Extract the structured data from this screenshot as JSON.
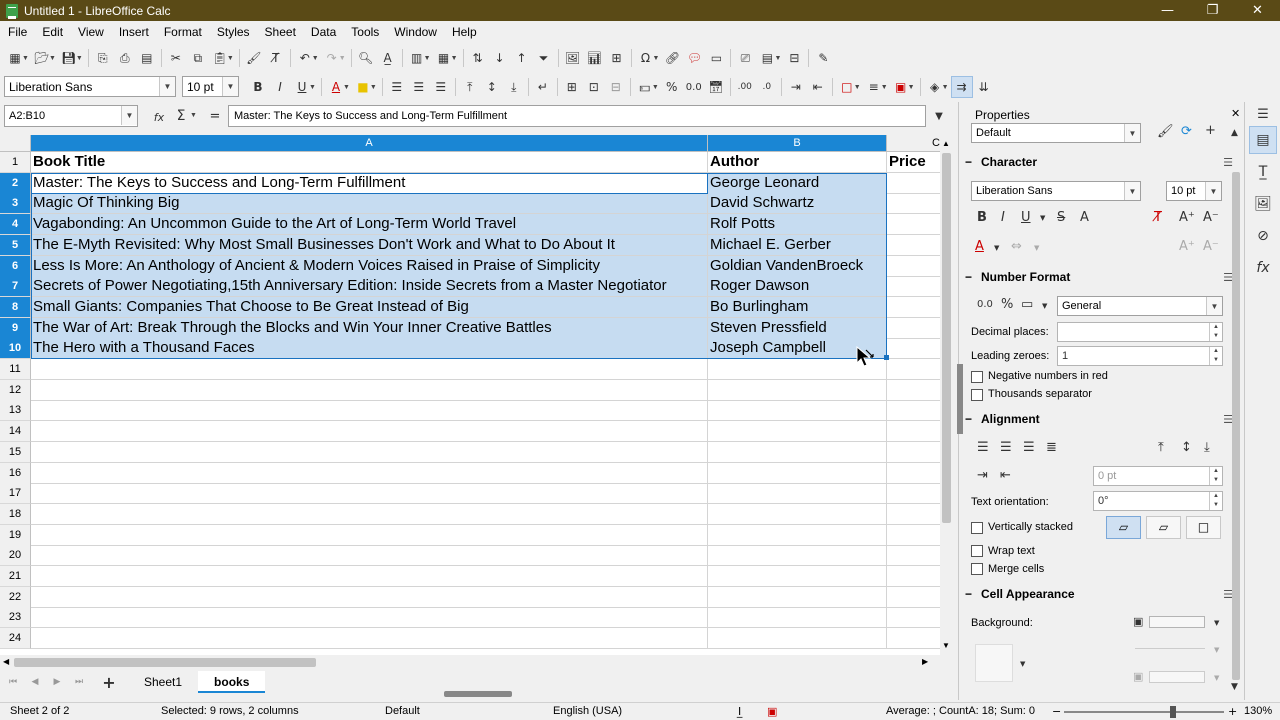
{
  "window": {
    "title": "Untitled 1 - LibreOffice Calc",
    "controls": [
      "—",
      "❐",
      "✕"
    ]
  },
  "menu": [
    "File",
    "Edit",
    "View",
    "Insert",
    "Format",
    "Styles",
    "Sheet",
    "Data",
    "Tools",
    "Window",
    "Help"
  ],
  "format_toolbar": {
    "font_name": "Liberation Sans",
    "font_size": "10 pt"
  },
  "formula_bar": {
    "name_box": "A2:B10",
    "sum_symbol": "Σ",
    "equals": "=",
    "fx": "fx",
    "content": "Master: The Keys to Success and Long-Term Fulfillment"
  },
  "sheet": {
    "columns": [
      "A",
      "B",
      "C"
    ],
    "rows": [
      "1",
      "2",
      "3",
      "4",
      "5",
      "6",
      "7",
      "8",
      "9",
      "10",
      "11",
      "12",
      "13",
      "14",
      "15",
      "16",
      "17",
      "18",
      "19",
      "20",
      "21",
      "22",
      "23",
      "24"
    ],
    "header": [
      "Book Title",
      "Author",
      "Price"
    ],
    "data": [
      [
        "Master: The Keys to Success and Long-Term Fulfillment",
        "George Leonard"
      ],
      [
        "Magic Of Thinking Big",
        "David Schwartz"
      ],
      [
        "Vagabonding: An Uncommon Guide to the Art of Long-Term World Travel",
        "Rolf Potts"
      ],
      [
        "The E-Myth Revisited: Why Most Small Businesses Don't Work and What to Do About It",
        "Michael E. Gerber"
      ],
      [
        "Less Is More: An Anthology of Ancient & Modern Voices Raised in Praise of Simplicity",
        "Goldian VandenBroeck"
      ],
      [
        "Secrets of Power Negotiating,15th Anniversary Edition: Inside Secrets from a Master Negotiator",
        "Roger Dawson"
      ],
      [
        "Small Giants: Companies That Choose to Be Great Instead of Big",
        "Bo Burlingham"
      ],
      [
        "The War of Art: Break Through the Blocks and Win Your Inner Creative Battles",
        "Steven Pressfield"
      ],
      [
        "The Hero with a Thousand Faces",
        "Joseph Campbell"
      ]
    ]
  },
  "tabs": {
    "add": "+",
    "sheets": [
      "Sheet1",
      "books"
    ],
    "active": "books"
  },
  "status": {
    "sheet": "Sheet 2 of 2",
    "selection": "Selected: 9 rows, 2 columns",
    "style": "Default",
    "language": "English (USA)",
    "summary": "Average: ; CountA: 18; Sum: 0",
    "zoom": "130%"
  },
  "sidebar": {
    "title": "Properties",
    "style": "Default",
    "character": {
      "label": "Character",
      "font": "Liberation Sans",
      "size": "10 pt"
    },
    "number_format": {
      "label": "Number Format",
      "format": "General",
      "decimal_places_label": "Decimal places:",
      "decimal_places": "",
      "leading_zeroes_label": "Leading zeroes:",
      "leading_zeroes": "1",
      "negative_red": "Negative numbers in red",
      "thousands": "Thousands separator"
    },
    "alignment": {
      "label": "Alignment",
      "indent": "0 pt",
      "orientation_label": "Text orientation:",
      "orientation": "0°",
      "vertically_stacked": "Vertically stacked",
      "wrap": "Wrap text",
      "merge": "Merge cells"
    },
    "cell_appearance": {
      "label": "Cell Appearance",
      "background_label": "Background:"
    }
  }
}
